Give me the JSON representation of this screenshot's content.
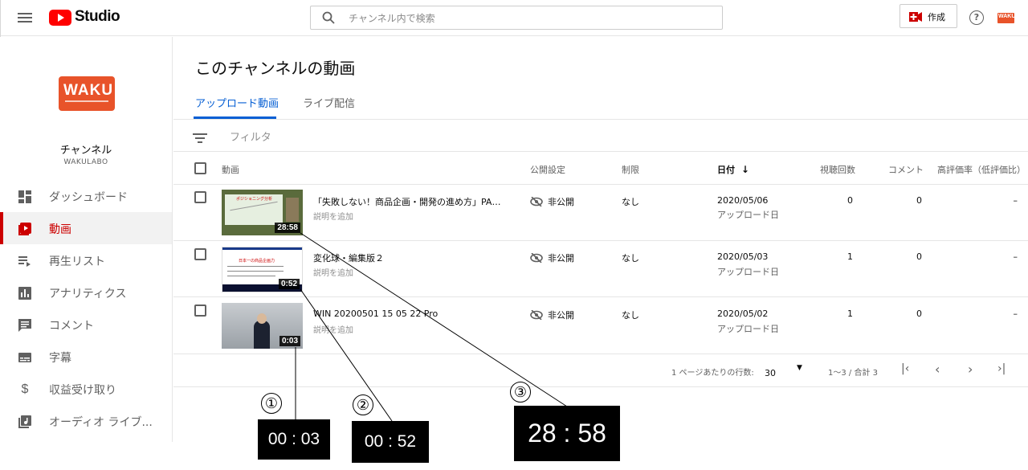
{
  "header": {
    "logo_text": "Studio",
    "search_placeholder": "チャンネル内で検索",
    "create_label": "作成",
    "account_badge": "WAKU"
  },
  "sidebar": {
    "channel_logo_text": "WAKU",
    "channel_label": "チャンネル",
    "channel_name": "WAKULABO",
    "items": [
      {
        "label": "ダッシュボード",
        "icon": "dashboard-icon"
      },
      {
        "label": "動画",
        "icon": "video-icon",
        "active": true
      },
      {
        "label": "再生リスト",
        "icon": "playlist-icon"
      },
      {
        "label": "アナリティクス",
        "icon": "analytics-icon"
      },
      {
        "label": "コメント",
        "icon": "comment-icon"
      },
      {
        "label": "字幕",
        "icon": "subtitles-icon"
      },
      {
        "label": "収益受け取り",
        "icon": "dollar-icon"
      },
      {
        "label": "オーディオ ライブ...",
        "icon": "audio-library-icon"
      }
    ]
  },
  "main": {
    "page_title": "このチャンネルの動画",
    "tabs": [
      {
        "label": "アップロード動画",
        "active": true
      },
      {
        "label": "ライブ配信",
        "active": false
      }
    ],
    "filter_label": "フィルタ",
    "columns": {
      "video": "動画",
      "visibility": "公開設定",
      "restrictions": "制限",
      "date": "日付",
      "views": "視聴回数",
      "comments": "コメント",
      "likes": "高評価率（低評価比）"
    },
    "rows": [
      {
        "title": "「失敗しない！商品企画・開発の進め方」PAR...",
        "desc": "説明を追加",
        "duration": "28:58",
        "visibility": "非公開",
        "restriction": "なし",
        "date": "2020/05/06",
        "date_sub": "アップロード日",
        "views": "0",
        "comments": "0",
        "likes": "–",
        "thumb_text": "ポジショニング分析"
      },
      {
        "title": "変化球・編集版２",
        "desc": "説明を追加",
        "duration": "0:52",
        "visibility": "非公開",
        "restriction": "なし",
        "date": "2020/05/03",
        "date_sub": "アップロード日",
        "views": "1",
        "comments": "0",
        "likes": "–",
        "thumb_text": "日本一の商品企画力"
      },
      {
        "title": "WIN 20200501 15 05 22 Pro",
        "desc": "説明を追加",
        "duration": "0:03",
        "visibility": "非公開",
        "restriction": "なし",
        "date": "2020/05/02",
        "date_sub": "アップロード日",
        "views": "1",
        "comments": "0",
        "likes": "–",
        "thumb_text": ""
      }
    ],
    "pagination": {
      "rows_per_page_label": "1 ページあたりの行数:",
      "rows_per_page_value": "30",
      "range": "1～3 / 合計 3"
    }
  },
  "callouts": [
    {
      "number": "①",
      "value": "00 : 03"
    },
    {
      "number": "②",
      "value": "00 : 52"
    },
    {
      "number": "③",
      "value": "28 : 58"
    }
  ],
  "colors": {
    "accent_red": "#cc0000",
    "tab_blue": "#065fd4",
    "brand_red": "#ff0000",
    "logo_orange": "#e8532a"
  }
}
